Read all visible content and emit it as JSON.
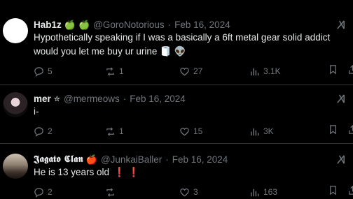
{
  "posts": [
    {
      "name": "Hab1z",
      "badges": [
        "🍏",
        "🍏"
      ],
      "handle": "@GoroNotorious",
      "date": "Feb 16, 2024",
      "text_line1": "Hypothetically speaking if I was a basically a 6ft metal gear solid addict",
      "text_line2": "would you let me buy ur urine",
      "text_emojis": "🧻 👽",
      "replies": "5",
      "reposts": "1",
      "likes": "27",
      "views": "3.1K"
    },
    {
      "name": "mer",
      "badge": "✮",
      "handle": "@mermeows",
      "date": "Feb 16, 2024",
      "text": "i-",
      "replies": "2",
      "reposts": "1",
      "likes": "15",
      "views": "3K"
    },
    {
      "name": "𝕵𝖆𝖌𝖆𝖙𝖔 𝕮𝖑𝖆𝖓",
      "badge": "🍎",
      "handle": "@JunkaiBaller",
      "date": "Feb 16, 2024",
      "text": "He is 13 years old",
      "text_emojis": "❗ ❗",
      "replies": "2",
      "reposts": "",
      "likes": "3",
      "views": "163"
    }
  ],
  "separator": "·"
}
